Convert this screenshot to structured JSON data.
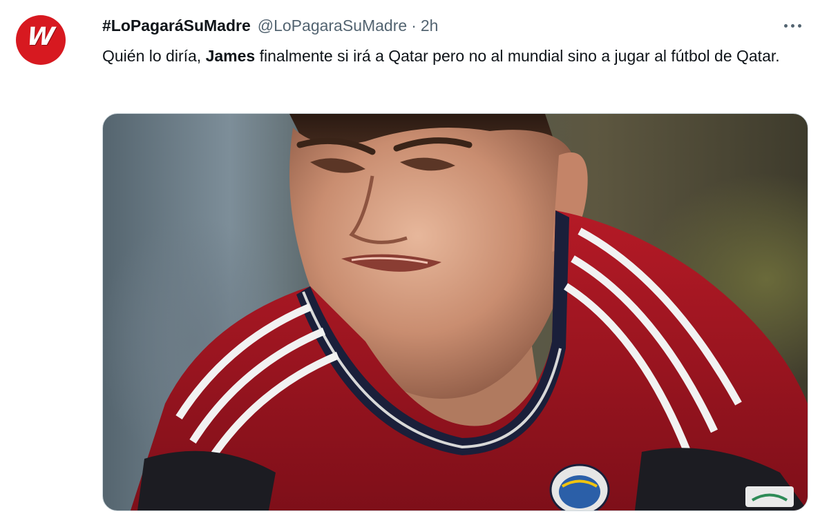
{
  "tweet": {
    "display_name": "#LoPagaráSuMadre",
    "handle": "@LoPagaraSuMadre",
    "separator": "·",
    "time": "2h",
    "text_before": "Quién lo diría, ",
    "text_bold": "James",
    "text_after": " finalmente si irá a Qatar pero no al mundial sino a jugar al fútbol de Qatar.",
    "more_icon": "more-horizontal-icon",
    "avatar": {
      "logo_text": "W",
      "logo_colors": {
        "background": "#d71920",
        "foreground": "#ffffff"
      }
    },
    "media": {
      "kind": "photo",
      "colors": {
        "jersey": "#a3141f",
        "stripes": "#f2f2f2",
        "collar": "#1a1f3a"
      }
    }
  },
  "colors": {
    "text_primary": "#0f1419",
    "text_secondary": "#536471",
    "border": "#cfd9de"
  }
}
